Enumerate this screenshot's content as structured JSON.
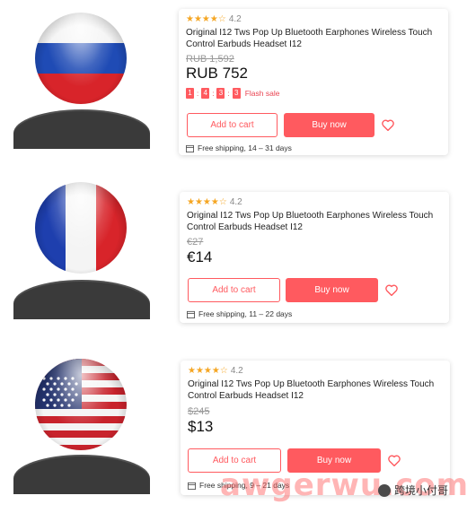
{
  "products": [
    {
      "rating": "4.2",
      "title_line1": "Original I12 Tws Pop Up Bluetooth Earphones Wireless Touch",
      "title_line2": "Control Earbuds Headset I12",
      "old_price": "RUB 1,592",
      "price": "RUB 752",
      "flash_digits": [
        "1",
        "4",
        "3",
        "3"
      ],
      "flash_label": "Flash sale",
      "add_to_cart": "Add to cart",
      "buy_now": "Buy now",
      "shipping": "Free shipping, 14 – 31 days",
      "flag": "russia-flag"
    },
    {
      "rating": "4.2",
      "title_line1": "Original I12 Tws Pop Up Bluetooth Earphones Wireless Touch",
      "title_line2": "Control Earbuds Headset I12",
      "old_price": "€27",
      "price": "€14",
      "add_to_cart": "Add to cart",
      "buy_now": "Buy now",
      "shipping": "Free shipping, 11 – 22 days",
      "flag": "france-flag"
    },
    {
      "rating": "4.2",
      "title_line1": "Original I12 Tws Pop Up Bluetooth Earphones Wireless Touch",
      "title_line2": "Control Earbuds Headset I12",
      "old_price": "$245",
      "price": "$13",
      "add_to_cart": "Add to cart",
      "buy_now": "Buy now",
      "shipping": "Free shipping, 9 – 21 days",
      "flag": "usa-flag"
    }
  ],
  "watermark": {
    "text": "awgerwu.com",
    "account": "跨境小付哥"
  },
  "colors": {
    "accent": "#ff5a5f",
    "star": "#f5a623",
    "avatar_body": "#3a3a3a"
  }
}
